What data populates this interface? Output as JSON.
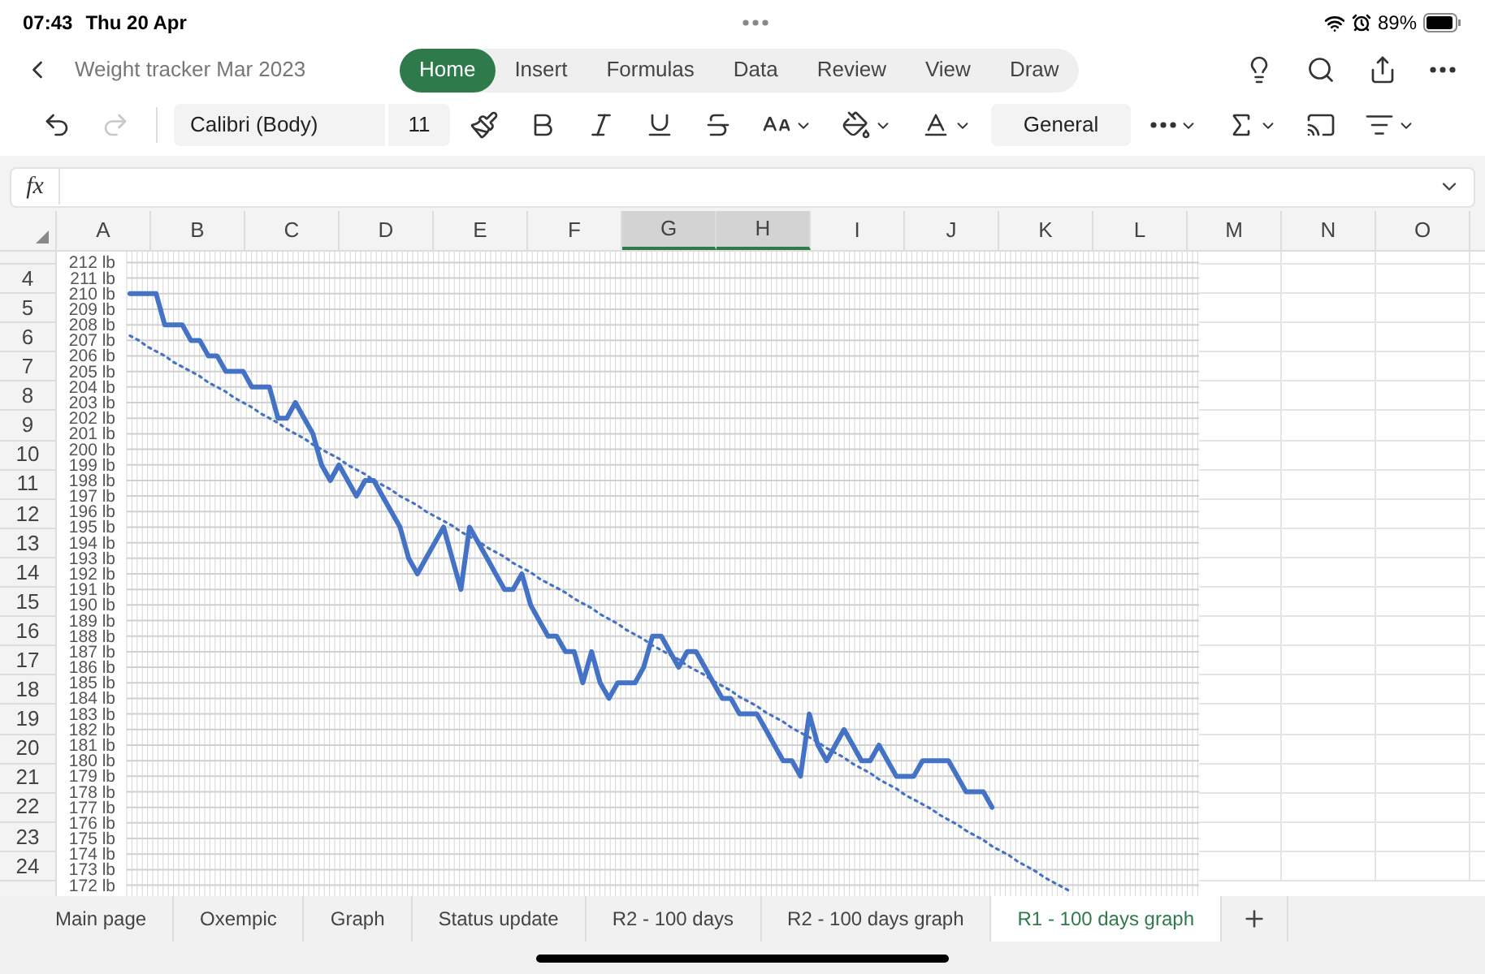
{
  "status_bar": {
    "time": "07:43",
    "date": "Thu 20 Apr",
    "battery": "89%"
  },
  "app_bar": {
    "title": "Weight tracker Mar 2023",
    "tabs": [
      {
        "label": "Home",
        "selected": true
      },
      {
        "label": "Insert",
        "selected": false
      },
      {
        "label": "Formulas",
        "selected": false
      },
      {
        "label": "Data",
        "selected": false
      },
      {
        "label": "Review",
        "selected": false
      },
      {
        "label": "View",
        "selected": false
      },
      {
        "label": "Draw",
        "selected": false
      }
    ]
  },
  "toolbar": {
    "undo_disabled": false,
    "redo_disabled": true,
    "font_name": "Calibri (Body)",
    "font_size": "11",
    "number_format": "General"
  },
  "formula_bar": {
    "label": "fx"
  },
  "columns": [
    {
      "label": "A",
      "selected": false
    },
    {
      "label": "B",
      "selected": false
    },
    {
      "label": "C",
      "selected": false
    },
    {
      "label": "D",
      "selected": false
    },
    {
      "label": "E",
      "selected": false
    },
    {
      "label": "F",
      "selected": false
    },
    {
      "label": "G",
      "selected": true
    },
    {
      "label": "H",
      "selected": true
    },
    {
      "label": "I",
      "selected": false
    },
    {
      "label": "J",
      "selected": false
    },
    {
      "label": "K",
      "selected": false
    },
    {
      "label": "L",
      "selected": false
    },
    {
      "label": "M",
      "selected": false
    },
    {
      "label": "N",
      "selected": false
    },
    {
      "label": "O",
      "selected": false
    }
  ],
  "rows": [
    "4",
    "5",
    "6",
    "7",
    "8",
    "9",
    "10",
    "11",
    "12",
    "13",
    "14",
    "15",
    "16",
    "17",
    "18",
    "19",
    "20",
    "21",
    "22",
    "23",
    "24"
  ],
  "chart": {
    "chart_data": {
      "type": "line",
      "grid": true,
      "series": [
        {
          "color": "#4472c4",
          "line_style": "solid",
          "values": [
            210,
            210,
            210,
            210,
            208,
            208,
            208,
            207,
            207,
            206,
            206,
            205,
            205,
            205,
            204,
            204,
            204,
            202,
            202,
            203,
            202,
            201,
            199,
            198,
            199,
            198,
            197,
            198,
            198,
            197,
            196,
            195,
            193,
            192,
            193,
            194,
            195,
            193,
            191,
            195,
            194,
            193,
            192,
            191,
            191,
            192,
            190,
            189,
            188,
            188,
            187,
            187,
            185,
            187,
            185,
            184,
            185,
            185,
            185,
            186,
            188,
            188,
            187,
            186,
            187,
            187,
            186,
            185,
            184,
            184,
            183,
            183,
            183,
            182,
            181,
            180,
            180,
            179,
            183,
            181,
            180,
            181,
            182,
            181,
            180,
            180,
            181,
            180,
            179,
            179,
            179,
            180,
            180,
            180,
            180,
            179,
            178,
            178,
            178,
            177,
            null,
            null,
            null,
            null,
            null,
            null,
            null,
            null,
            null
          ]
        },
        {
          "color": "#4472c4",
          "line_style": "dotted",
          "values": [
            207.3,
            207,
            206.6,
            206.3,
            206,
            205.6,
            205.3,
            205,
            204.7,
            204.3,
            204,
            203.7,
            203.3,
            203,
            202.7,
            202.3,
            202,
            201.7,
            201.3,
            201,
            200.7,
            200.3,
            200,
            199.7,
            199.4,
            199,
            198.7,
            198.4,
            198,
            197.7,
            197.4,
            197,
            196.7,
            196.4,
            196,
            195.7,
            195.4,
            195.1,
            194.7,
            194.4,
            194.1,
            193.7,
            193.4,
            193.1,
            192.7,
            192.4,
            192.1,
            191.7,
            191.4,
            191.1,
            190.8,
            190.4,
            190.1,
            189.8,
            189.4,
            189.1,
            188.8,
            188.4,
            188.1,
            187.8,
            187.4,
            187.1,
            186.8,
            186.5,
            186.1,
            185.8,
            185.5,
            185.1,
            184.8,
            184.5,
            184.1,
            183.8,
            183.5,
            183.1,
            182.8,
            182.5,
            182.1,
            181.8,
            181.5,
            181.2,
            180.8,
            180.5,
            180.2,
            179.8,
            179.5,
            179.2,
            178.8,
            178.5,
            178.2,
            177.8,
            177.5,
            177.2,
            176.9,
            176.5,
            176.2,
            175.9,
            175.5,
            175.2,
            174.9,
            174.5,
            174.2,
            173.9,
            173.5,
            173.2,
            172.9,
            172.5,
            172.2,
            171.9,
            171.6
          ]
        }
      ],
      "ylim": [
        171.3,
        212.7
      ],
      "yticks": [
        {
          "value": 172,
          "label": "172 lb"
        },
        {
          "value": 173,
          "label": "173 lb"
        },
        {
          "value": 174,
          "label": "174 lb"
        },
        {
          "value": 175,
          "label": "175 lb"
        },
        {
          "value": 176,
          "label": "176 lb"
        },
        {
          "value": 177,
          "label": "177 lb"
        },
        {
          "value": 178,
          "label": "178 lb"
        },
        {
          "value": 179,
          "label": "179 lb"
        },
        {
          "value": 180,
          "label": "180 lb"
        },
        {
          "value": 181,
          "label": "181 lb"
        },
        {
          "value": 182,
          "label": "182 lb"
        },
        {
          "value": 183,
          "label": "183 lb"
        },
        {
          "value": 184,
          "label": "184 lb"
        },
        {
          "value": 185,
          "label": "185 lb"
        },
        {
          "value": 186,
          "label": "186 lb"
        },
        {
          "value": 187,
          "label": "187 lb"
        },
        {
          "value": 188,
          "label": "188 lb"
        },
        {
          "value": 189,
          "label": "189 lb"
        },
        {
          "value": 190,
          "label": "190 lb"
        },
        {
          "value": 191,
          "label": "191 lb"
        },
        {
          "value": 192,
          "label": "192 lb"
        },
        {
          "value": 193,
          "label": "193 lb"
        },
        {
          "value": 194,
          "label": "194 lb"
        },
        {
          "value": 195,
          "label": "195 lb"
        },
        {
          "value": 196,
          "label": "196 lb"
        },
        {
          "value": 197,
          "label": "197 lb"
        },
        {
          "value": 198,
          "label": "198 lb"
        },
        {
          "value": 199,
          "label": "199 lb"
        },
        {
          "value": 200,
          "label": "200 lb"
        },
        {
          "value": 201,
          "label": "201 lb"
        },
        {
          "value": 202,
          "label": "202 lb"
        },
        {
          "value": 203,
          "label": "203 lb"
        },
        {
          "value": 204,
          "label": "204 lb"
        },
        {
          "value": 205,
          "label": "205 lb"
        },
        {
          "value": 206,
          "label": "206 lb"
        },
        {
          "value": 207,
          "label": "207 lb"
        },
        {
          "value": 208,
          "label": "208 lb"
        },
        {
          "value": 209,
          "label": "209 lb"
        },
        {
          "value": 210,
          "label": "210 lb"
        },
        {
          "value": 211,
          "label": "211 lb"
        },
        {
          "value": 212,
          "label": "212 lb"
        }
      ]
    }
  },
  "sheet_tabs": [
    {
      "label": "Main page",
      "selected": false
    },
    {
      "label": "Oxempic",
      "selected": false
    },
    {
      "label": "Graph",
      "selected": false
    },
    {
      "label": "Status update",
      "selected": false
    },
    {
      "label": "R2 - 100 days",
      "selected": false
    },
    {
      "label": "R2 - 100 days graph",
      "selected": false
    },
    {
      "label": "R1 - 100 days graph",
      "selected": true
    }
  ]
}
